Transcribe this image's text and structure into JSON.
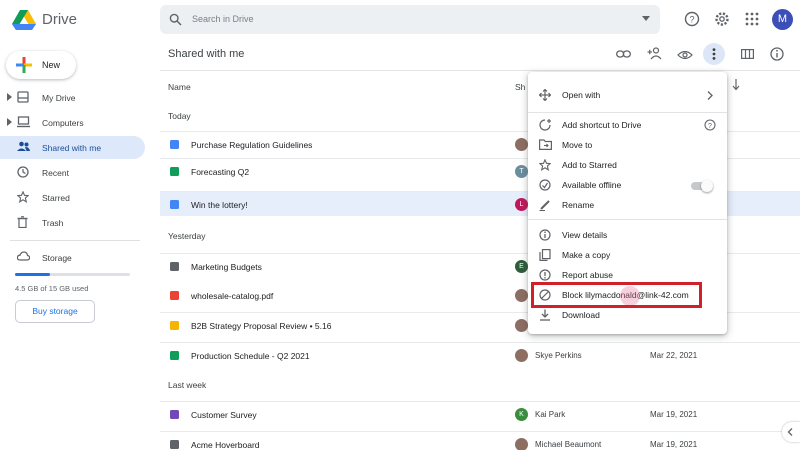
{
  "app": {
    "name": "Drive",
    "avatar_letter": "M"
  },
  "search": {
    "placeholder": "Search in Drive"
  },
  "sidebar": {
    "new_label": "New",
    "items": [
      {
        "label": "My Drive",
        "icon": "my-drive-icon"
      },
      {
        "label": "Computers",
        "icon": "computer-icon"
      },
      {
        "label": "Shared with me",
        "icon": "people-icon"
      },
      {
        "label": "Recent",
        "icon": "clock-icon"
      },
      {
        "label": "Starred",
        "icon": "star-icon"
      },
      {
        "label": "Trash",
        "icon": "trash-icon"
      }
    ],
    "storage": {
      "label": "Storage",
      "used_text": "4.5 GB of 15 GB used",
      "used_fraction": 0.3,
      "buy_label": "Buy storage"
    }
  },
  "main": {
    "title": "Shared with me",
    "columns": {
      "name": "Name",
      "shared": "Sh"
    },
    "sections": {
      "today": "Today",
      "yesterday": "Yesterday",
      "last_week": "Last week"
    },
    "rows": [
      {
        "name": "Purchase Regulation Guidelines",
        "type": "doc",
        "avatar": "",
        "owner": "",
        "date": ""
      },
      {
        "name": "Forecasting Q2",
        "type": "sheet",
        "avatar": "T",
        "owner": "",
        "date": ""
      },
      {
        "name": "Win the lottery!",
        "type": "doc",
        "avatar": "L",
        "owner": "",
        "date": ""
      },
      {
        "name": "Marketing Budgets",
        "type": "folder",
        "avatar": "E",
        "owner": "",
        "date": ""
      },
      {
        "name": "wholesale-catalog.pdf",
        "type": "pdf",
        "avatar": "",
        "owner": "",
        "date": ""
      },
      {
        "name": "B2B Strategy Proposal Review • 5.16",
        "type": "slides",
        "avatar": "",
        "owner": "",
        "date": ""
      },
      {
        "name": "Production Schedule - Q2 2021",
        "type": "sheet",
        "avatar": "",
        "owner": "Skye Perkins",
        "date": "Mar 22, 2021"
      },
      {
        "name": "Customer Survey",
        "type": "form",
        "avatar": "K",
        "owner": "Kai Park",
        "date": "Mar 19, 2021"
      },
      {
        "name": "Acme Hoverboard",
        "type": "folder",
        "avatar": "",
        "owner": "Michael Beaumont",
        "date": "Mar 19, 2021"
      }
    ]
  },
  "context_menu": {
    "items": [
      {
        "label": "Open with",
        "icon": "move-arrows-icon"
      },
      {
        "label": "Add shortcut to Drive",
        "icon": "add-shortcut-icon"
      },
      {
        "label": "Move to",
        "icon": "move-folder-icon"
      },
      {
        "label": "Add to Starred",
        "icon": "star-icon"
      },
      {
        "label": "Available offline",
        "icon": "offline-icon"
      },
      {
        "label": "Rename",
        "icon": "pencil-icon"
      },
      {
        "label": "View details",
        "icon": "info-icon"
      },
      {
        "label": "Make a copy",
        "icon": "copy-icon"
      },
      {
        "label": "Report abuse",
        "icon": "report-icon"
      },
      {
        "label": "Block lilymacdonald@link-42.com",
        "icon": "block-icon"
      },
      {
        "label": "Download",
        "icon": "download-icon"
      }
    ]
  },
  "colors": {
    "accent": "#1a73e8",
    "highlight": "#d0202a",
    "selected_row": "#e6eefc"
  }
}
